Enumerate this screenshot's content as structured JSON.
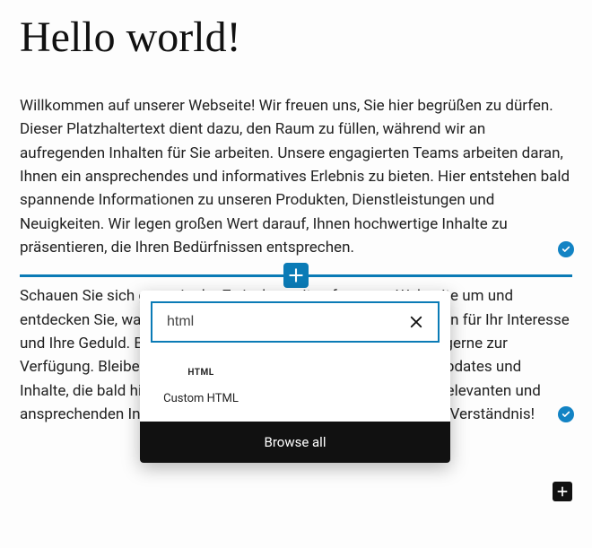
{
  "title": "Hello world!",
  "para1": "Willkommen auf unserer Webseite! Wir freuen uns, Sie hier begrüßen zu dürfen. Dieser Platzhaltertext dient dazu, den Raum zu füllen, während wir an aufregenden Inhalten für Sie arbeiten. Unsere engagierten Teams arbeiten daran, Ihnen ein ansprechendes und informatives Erlebnis zu bieten. Hier entstehen bald spannende Informationen zu unseren Produkten, Dienstleistungen und Neuigkeiten. Wir legen großen Wert darauf, Ihnen hochwertige Inhalte zu präsentieren, die Ihren Bedürfnissen entsprechen.",
  "para2": "Schauen Sie sich gerne in der Zwischenzeit auf unserer Webseite um und entdecken Sie, was wir bereits zu bieten haben. Wir danken Ihnen für Ihr Interesse und Ihre Geduld. Bei Fragen oder Anregungen stehen wir Ihnen gerne zur Verfügung. Bleiben Sie gespannt und freuen auf die neuesten Updates und Inhalte, die bald hier erscheinen werden, um Sie in Zukunft mit relevanten und ansprechenden Informationen zu versorgen. Vielen Dank für Ihr Verständnis!",
  "inserter": {
    "search_value": "html",
    "result_icon_text": "HTML",
    "result_label": "Custom HTML",
    "browse_label": "Browse all"
  }
}
